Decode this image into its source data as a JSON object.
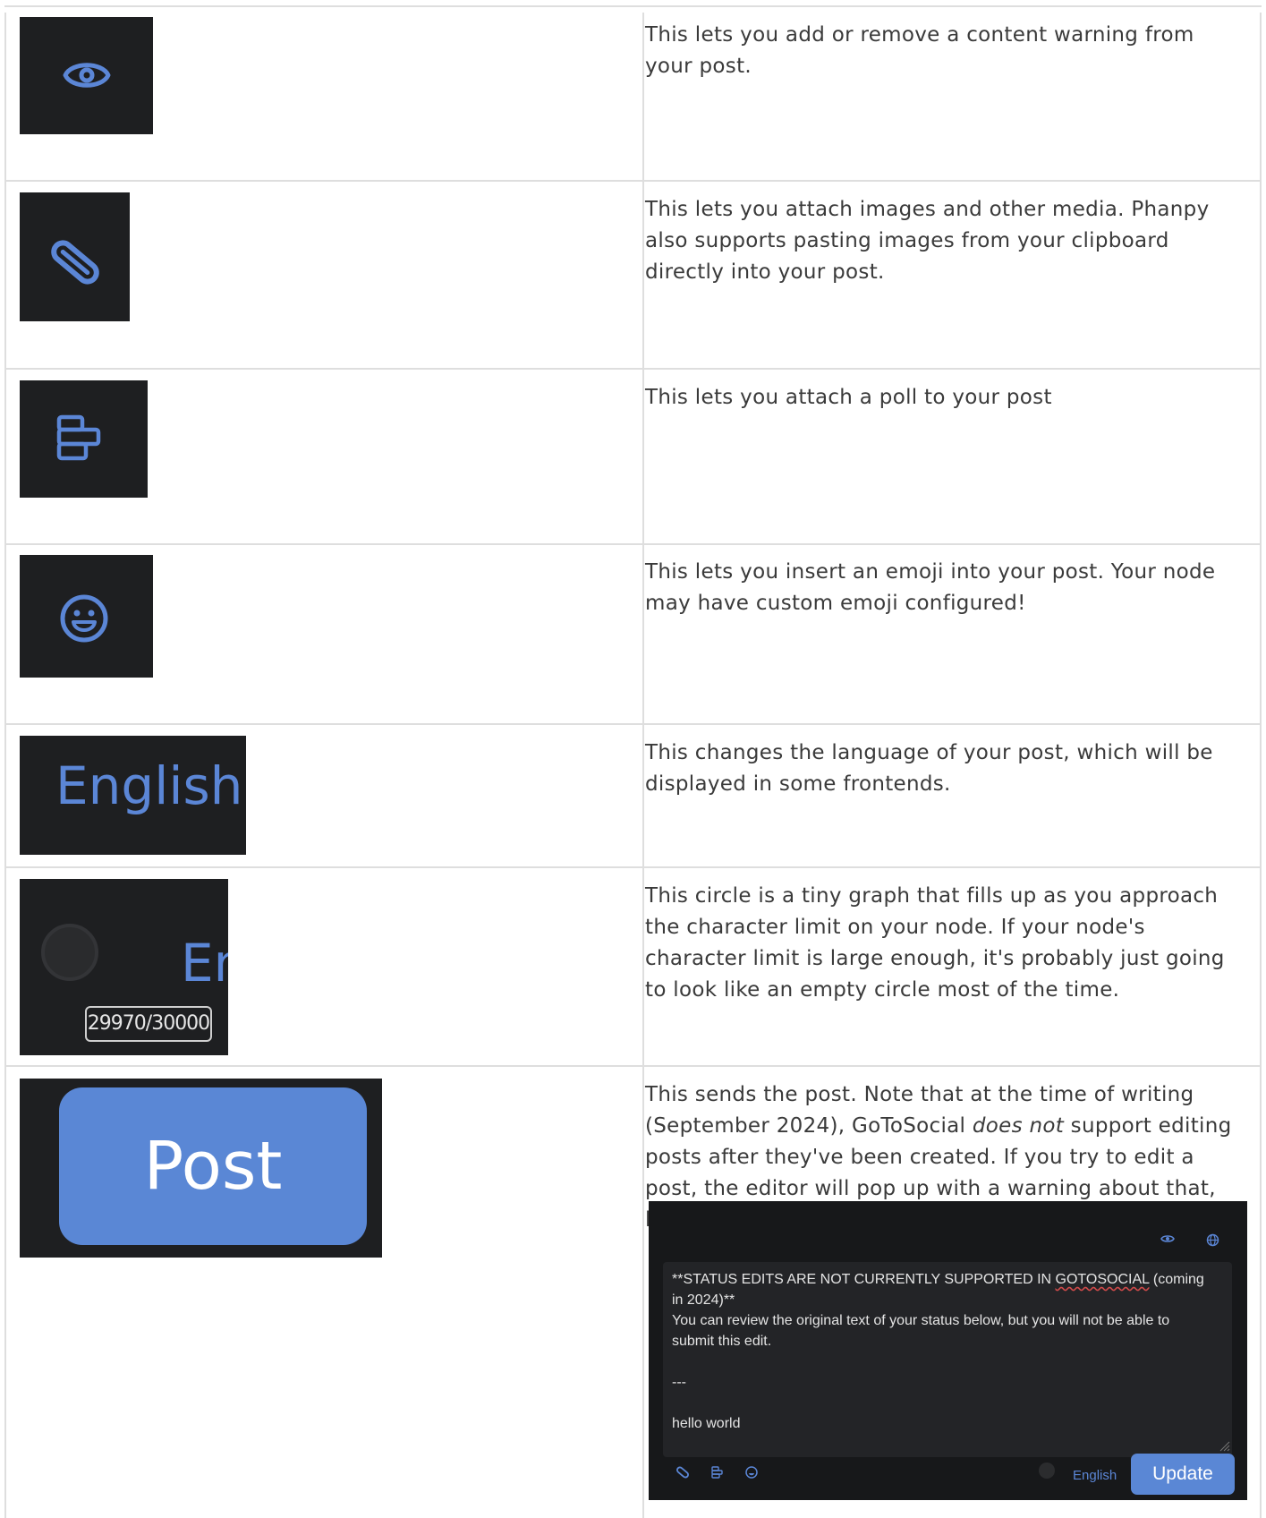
{
  "rows": [
    {
      "icon": "eye-icon",
      "description": "This lets you add or remove a content warning from your post."
    },
    {
      "icon": "paperclip-icon",
      "description": "This lets you attach images and other media. Phanpy also supports pasting images from your clipboard directly into your post."
    },
    {
      "icon": "poll-icon",
      "description": "This lets you attach a poll to your post"
    },
    {
      "icon": "emoji-icon",
      "description": "This lets you insert an emoji into your post. Your node may have custom emoji configured!"
    },
    {
      "language_label": "English",
      "description": "This changes the language of your post, which will be displayed in some frontends."
    },
    {
      "counter": "29970/30000",
      "partial_language": "En",
      "description": "This circle is a tiny graph that fills up as you approach the character limit on your node. If your node's character limit is large enough, it's probably just going to look like an empty circle most of the time."
    },
    {
      "button_label": "Post",
      "description_before": "This sends the post. Note that at the time of writing (September 2024), GoToSocial ",
      "description_em": "does not",
      "description_after": " support editing posts after they've been created. If you try to edit a post, the editor will pop up with a warning about that, like this:"
    }
  ],
  "editor_screenshot": {
    "line1_a": "**STATUS EDITS ARE NOT CURRENTLY SUPPORTED IN ",
    "line1_b": "GOTOSOCIAL",
    "line1_c": " (coming in 2024)**",
    "line2": "You can review the original text of your status below, but you will not be able to submit this edit.",
    "line3": "---",
    "line4": "hello world",
    "language": "English",
    "update_label": "Update"
  },
  "colors": {
    "accent": "#5b86d6",
    "dark_bg": "#1e1f21",
    "border": "#dedede"
  }
}
